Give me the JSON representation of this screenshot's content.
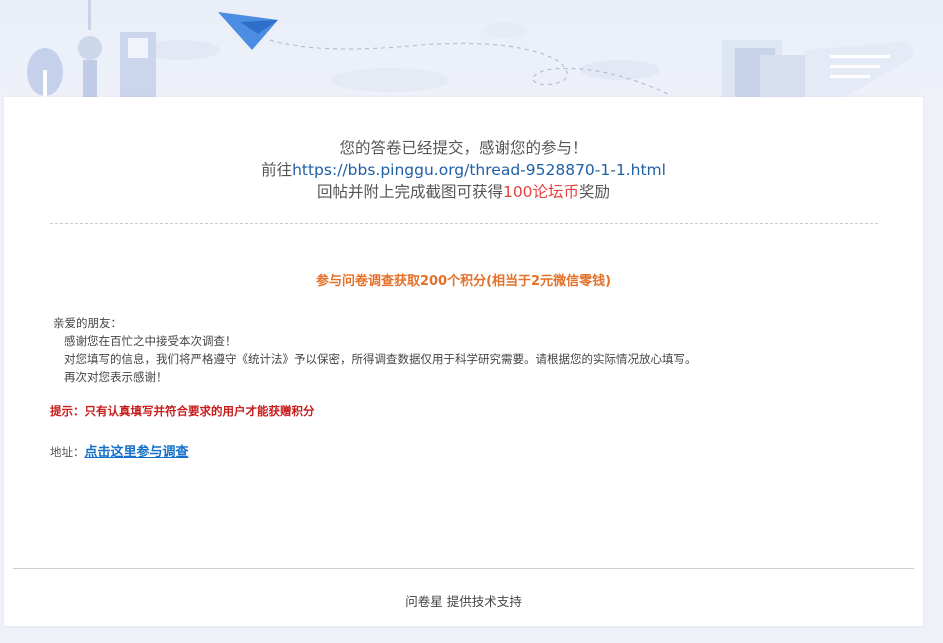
{
  "confirmation": {
    "line1": "您的答卷已经提交，感谢您的参与！",
    "line2_prefix": "前往",
    "line2_link": "https://bbs.pinggu.org/thread-9528870-1-1.html",
    "line3_prefix": "回帖并附上完成截图可获得",
    "line3_highlight": "100论坛币",
    "line3_suffix": "奖励"
  },
  "survey": {
    "title": "参与问卷调查获取200个积分(相当于2元微信零钱)",
    "greeting": "亲爱的朋友：",
    "para1": "感谢您在百忙之中接受本次调查！",
    "para2": "对您填写的信息，我们将严格遵守《统计法》予以保密，所得调查数据仅用于科学研究需要。请根据您的实际情况放心填写。",
    "para3": "再次对您表示感谢！",
    "tip": "提示：只有认真填写并符合要求的用户才能获赠积分",
    "address_label": "地址：",
    "address_link": "点击这里参与调查"
  },
  "footer": {
    "text": "问卷星 提供技术支持"
  },
  "colors": {
    "accent_orange": "#e3712a",
    "tip_red": "#c71d1d",
    "link_blue": "#1570c9",
    "reward_red": "#e4423f"
  }
}
